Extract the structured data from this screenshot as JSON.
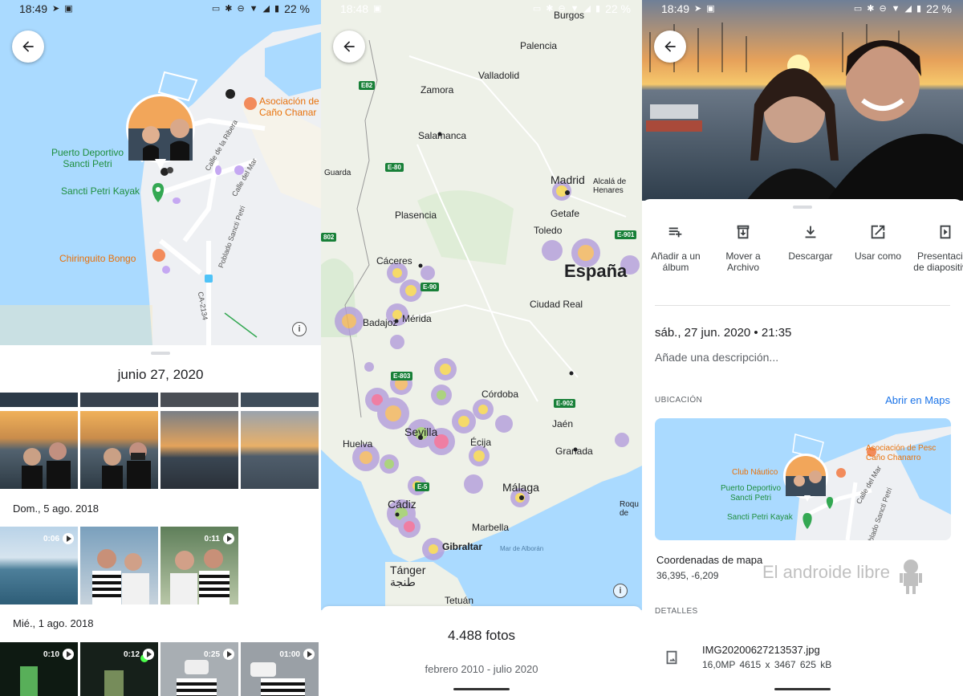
{
  "status_bars": [
    {
      "time": "18:49",
      "battery": "22 %"
    },
    {
      "time": "18:48",
      "battery": "22 %"
    },
    {
      "time": "18:49",
      "battery": "22 %"
    }
  ],
  "panel1": {
    "map_labels": {
      "puerto": "Puerto Deportivo\nSancti Petri",
      "kayak": "Sancti Petri Kayak",
      "chiringuito": "Chiringuito Bongo",
      "asociacion": "Asociación de\nCaño Chanar",
      "road1": "Calle de la Ribera",
      "road2": "Calle del Mar",
      "road3": "Poblado Sancti Petri",
      "road4": "CA-2134"
    },
    "date_title": "junio 27, 2020",
    "sections": [
      {
        "label": "Dom., 5 ago. 2018"
      },
      {
        "label": "Mié., 1 ago. 2018"
      }
    ],
    "video_durations": {
      "v1": "0:06",
      "v2": "0:11",
      "v3": "0:10",
      "v4": "0:12",
      "v5": "0:25",
      "v6": "01:00"
    }
  },
  "panel2": {
    "cities": {
      "burgos": "Burgos",
      "palencia": "Palencia",
      "valladolid": "Valladolid",
      "zamora": "Zamora",
      "salamanca": "Salamanca",
      "guarda": "Guarda",
      "madrid": "Madrid",
      "alcala": "Alcalá de\nHenares",
      "getafe": "Getafe",
      "plasencia": "Plasencia",
      "toledo": "Toledo",
      "caceres": "Cáceres",
      "espana": "España",
      "badajoz": "Badajoz",
      "merida": "Mérida",
      "ciudadreal": "Ciudad Real",
      "cordoba": "Córdoba",
      "jaen": "Jaén",
      "sevilla": "Sevilla",
      "ecija": "Écija",
      "granada": "Granada",
      "huelva": "Huelva",
      "malaga": "Málaga",
      "roque": "Roqu\nde",
      "cadiz": "Cádiz",
      "marbella": "Marbella",
      "gibraltar": "Gibraltar",
      "alboran": "Mar de Alborán",
      "tanger": "Tánger\nطنجة",
      "tetuan": "Tetuán"
    },
    "highways": {
      "e82": "E82",
      "e80": "E-80",
      "e90": "E-90",
      "e901": "E-901",
      "e803": "E-803",
      "e902": "E-902",
      "e5": "E-5",
      "h802": "802"
    },
    "photo_count": "4.488 fotos",
    "date_range": "febrero 2010 - julio 2020"
  },
  "panel3": {
    "actions": [
      {
        "label": "Añadir a un álbum",
        "icon": "add-to-album-icon"
      },
      {
        "label": "Mover a Archivo",
        "icon": "archive-icon"
      },
      {
        "label": "Descargar",
        "icon": "download-icon"
      },
      {
        "label": "Usar como",
        "icon": "open-external-icon"
      },
      {
        "label": "Presentación de diapositivas",
        "icon": "slideshow-icon"
      }
    ],
    "datetime": "sáb., 27 jun. 2020  •  21:35",
    "description_placeholder": "Añade una descripción...",
    "location_header": "UBICACIÓN",
    "open_maps": "Abrir en Maps",
    "minimap_labels": {
      "asociacion": "Asociación de Pesc\nCaño Chanarro",
      "club": "Club Náutico",
      "puerto": "Puerto Deportivo\nSancti Petri",
      "kayak": "Sancti Petri Kayak",
      "road1": "Calle del Mar",
      "road2": "Poblado Sancti Petri"
    },
    "coords_title": "Coordenadas de mapa",
    "coords_value": "36,395, -6,209",
    "watermark": "El androide libre",
    "details_header": "DETALLES",
    "file_name": "IMG20200627213537.jpg",
    "file_meta": "16,0MP   4615 x 3467   625 kB"
  },
  "colors": {
    "accent": "#1a73e8",
    "map_water": "#aadaff",
    "map_land": "#eef0f3",
    "park_green": "#1e8e3e"
  }
}
